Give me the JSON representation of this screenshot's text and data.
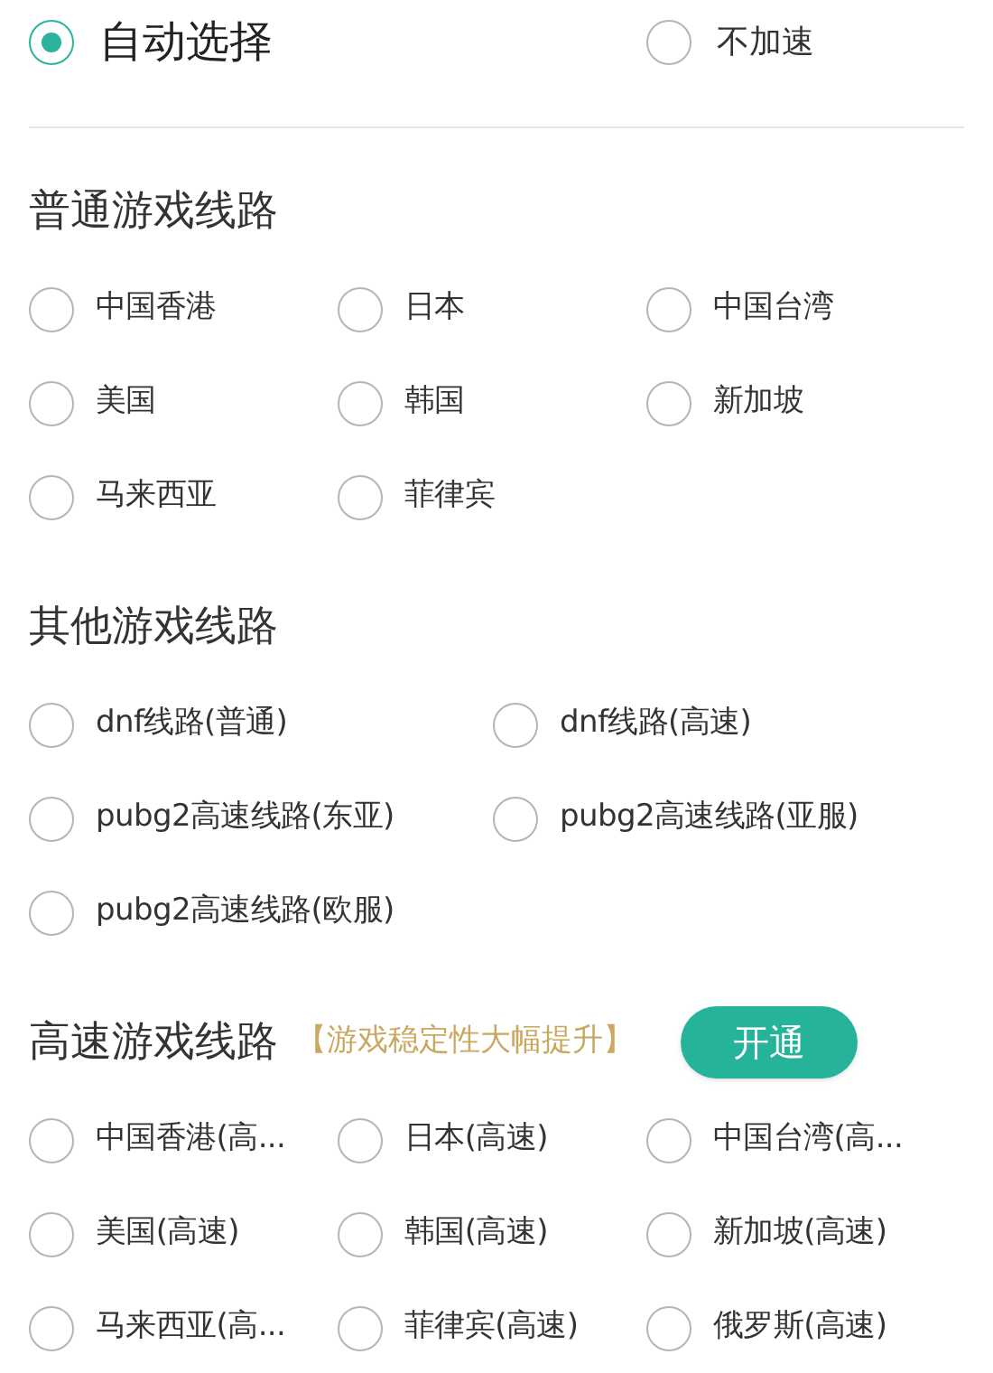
{
  "top_options": [
    {
      "label": "自动选择",
      "selected": true
    },
    {
      "label": "不加速",
      "selected": false
    }
  ],
  "sections": [
    {
      "title": "普通游戏线路",
      "kind": "narrow",
      "items": [
        {
          "label": "中国香港",
          "selected": false
        },
        {
          "label": "日本",
          "selected": false
        },
        {
          "label": "中国台湾",
          "selected": false
        },
        {
          "label": "美国",
          "selected": false
        },
        {
          "label": "韩国",
          "selected": false
        },
        {
          "label": "新加坡",
          "selected": false
        },
        {
          "label": "马来西亚",
          "selected": false
        },
        {
          "label": "菲律宾",
          "selected": false
        }
      ]
    },
    {
      "title": "其他游戏线路",
      "kind": "wide",
      "items": [
        {
          "label": "dnf线路(普通)",
          "selected": false
        },
        {
          "label": "dnf线路(高速)",
          "selected": false
        },
        {
          "label": "pubg2高速线路(东亚)",
          "selected": false
        },
        {
          "label": "pubg2高速线路(亚服)",
          "selected": false
        },
        {
          "label": "pubg2高速线路(欧服)",
          "selected": false
        }
      ]
    },
    {
      "title": "高速游戏线路",
      "note": "【游戏稳定性大幅提升】",
      "button": "开通",
      "kind": "narrow",
      "items": [
        {
          "label": "中国香港(高...",
          "selected": false
        },
        {
          "label": "日本(高速)",
          "selected": false
        },
        {
          "label": "中国台湾(高...",
          "selected": false
        },
        {
          "label": "美国(高速)",
          "selected": false
        },
        {
          "label": "韩国(高速)",
          "selected": false
        },
        {
          "label": "新加坡(高速)",
          "selected": false
        },
        {
          "label": "马来西亚(高...",
          "selected": false
        },
        {
          "label": "菲律宾(高速)",
          "selected": false
        },
        {
          "label": "俄罗斯(高速)",
          "selected": false
        }
      ]
    }
  ]
}
